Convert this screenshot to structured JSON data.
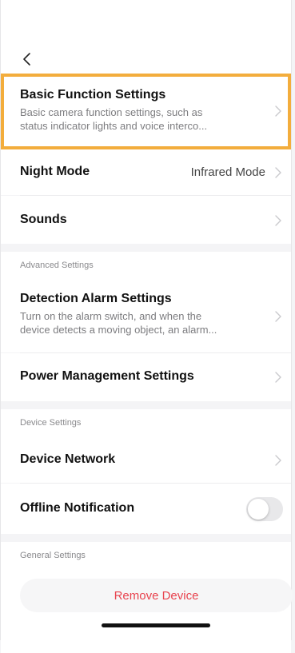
{
  "nav": {
    "back_icon": "chevron-left-icon"
  },
  "basic": {
    "title": "Basic Function Settings",
    "desc_line1": "Basic camera function settings, such as",
    "desc_line2": "status indicator lights and voice interco..."
  },
  "night_mode": {
    "label": "Night Mode",
    "value": "Infrared Mode"
  },
  "sounds": {
    "label": "Sounds"
  },
  "advanced": {
    "header": "Advanced Settings",
    "detection": {
      "title": "Detection Alarm Settings",
      "desc_line1": "Turn on the alarm switch, and when the",
      "desc_line2": "device detects a moving object, an alarm..."
    },
    "power": {
      "label": "Power Management Settings"
    }
  },
  "device": {
    "header": "Device Settings",
    "network": {
      "label": "Device Network"
    },
    "offline": {
      "label": "Offline Notification",
      "enabled": false
    }
  },
  "general": {
    "header": "General Settings",
    "remove_label": "Remove Device"
  },
  "colors": {
    "highlight": "#f3ad3c",
    "danger": "#e8434e"
  }
}
